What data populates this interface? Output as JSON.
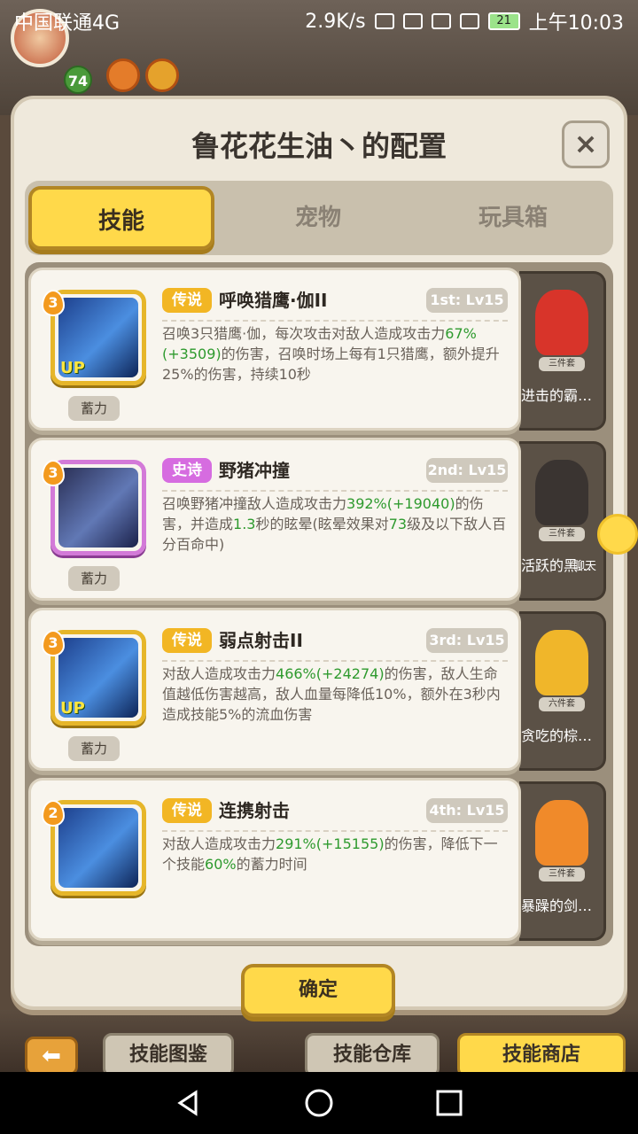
{
  "status_bar": {
    "carrier": "中国联通4G",
    "speed": "2.9K/s",
    "battery": "21",
    "time": "上午10:03"
  },
  "player": {
    "level": "74"
  },
  "dialog": {
    "title": "鲁花花生油丶的配置",
    "close_label": "×",
    "tabs": [
      {
        "label": "技能",
        "active": true
      },
      {
        "label": "宠物",
        "active": false
      },
      {
        "label": "玩具箱",
        "active": false
      }
    ],
    "skills": [
      {
        "stars": "3",
        "rarity": "传说",
        "name": "呼唤猎鹰·伽II",
        "rank": "1st: Lv15",
        "charge": "蓄力",
        "up": "UP",
        "desc_parts": [
          {
            "t": "召唤3只猎鹰·伽，每次攻击对敌人造成攻击力",
            "hl": false
          },
          {
            "t": "67%",
            "hl": true
          },
          {
            "t": "(+3509)",
            "hl": true
          },
          {
            "t": "的伤害，召唤时场上每有1只猎鹰，额外提升25%的伤害，持续10秒",
            "hl": false
          }
        ]
      },
      {
        "stars": "3",
        "rarity": "史诗",
        "name": "野猪冲撞",
        "rank": "2nd: Lv15",
        "charge": "蓄力",
        "up": "",
        "desc_parts": [
          {
            "t": "召唤野猪冲撞敌人造成攻击力",
            "hl": false
          },
          {
            "t": "392%",
            "hl": true
          },
          {
            "t": "(+19040)",
            "hl": true
          },
          {
            "t": "的伤害，并造成",
            "hl": false
          },
          {
            "t": "1.3",
            "hl": true
          },
          {
            "t": "秒的眩晕(眩晕效果对",
            "hl": false
          },
          {
            "t": "73",
            "hl": true
          },
          {
            "t": "级及以下敌人百分百命中)",
            "hl": false
          }
        ]
      },
      {
        "stars": "3",
        "rarity": "传说",
        "name": "弱点射击II",
        "rank": "3rd: Lv15",
        "charge": "蓄力",
        "up": "UP",
        "desc_parts": [
          {
            "t": "对敌人造成攻击力",
            "hl": false
          },
          {
            "t": "466%",
            "hl": true
          },
          {
            "t": "(+24274)",
            "hl": true
          },
          {
            "t": "的伤害，敌人生命值越低伤害越高，敌人血量每降低10%，额外在3秒内造成技能5%的流血伤害",
            "hl": false
          }
        ]
      },
      {
        "stars": "2",
        "rarity": "传说",
        "name": "连携射击",
        "rank": "4th: Lv15",
        "charge": "",
        "up": "",
        "desc_parts": [
          {
            "t": "对敌人造成攻击力",
            "hl": false
          },
          {
            "t": "291%",
            "hl": true
          },
          {
            "t": "(+15155)",
            "hl": true
          },
          {
            "t": "的伤害，降低下一个技能",
            "hl": false
          },
          {
            "t": "60%",
            "hl": true
          },
          {
            "t": "的蓄力时间",
            "hl": false
          }
        ]
      }
    ],
    "side_items": [
      {
        "name": "进击的霸…",
        "tag": "三件套",
        "color": "#d8342a"
      },
      {
        "name": "活跃的黑…",
        "tag": "三件套",
        "color": "#3a3431"
      },
      {
        "name": "贪吃的棕…",
        "tag": "六件套",
        "color": "#f0b62a"
      },
      {
        "name": "暴躁的剑…",
        "tag": "三件套",
        "color": "#f08a2a"
      }
    ],
    "chat_label": "聊天",
    "confirm_label": "确定"
  },
  "bottom_bar": {
    "buttons": [
      "技能图鉴",
      "技能仓库",
      "技能商店"
    ]
  }
}
